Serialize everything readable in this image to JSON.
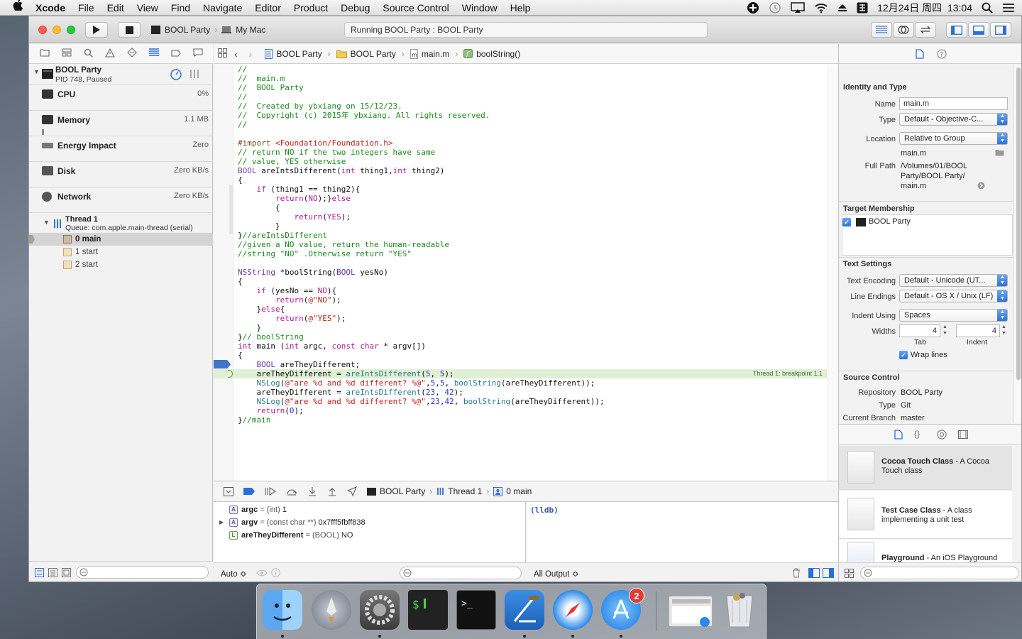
{
  "menubar": {
    "apple": "",
    "items": [
      "Xcode",
      "File",
      "Edit",
      "View",
      "Find",
      "Navigate",
      "Editor",
      "Product",
      "Debug",
      "Source Control",
      "Window",
      "Help"
    ],
    "clock": "12月24日 周四  13:04"
  },
  "toolbar": {
    "scheme": "BOOL Party",
    "destination": "My Mac",
    "activity": "Running BOOL Party : BOOL Party"
  },
  "navigator": {
    "process": {
      "name": "BOOL Party",
      "pid": "PID 748, Paused"
    },
    "gauges": [
      {
        "label": "CPU",
        "value": "0%"
      },
      {
        "label": "Memory",
        "value": "1.1 MB"
      },
      {
        "label": "Energy Impact",
        "value": "Zero"
      },
      {
        "label": "Disk",
        "value": "Zero KB/s"
      },
      {
        "label": "Network",
        "value": "Zero KB/s"
      }
    ],
    "thread": {
      "name": "Thread 1",
      "queue": "Queue: com.apple.main-thread (serial)"
    },
    "frames": [
      "0 main",
      "1 start",
      "2 start"
    ]
  },
  "jumpbar": {
    "project": "BOOL Party",
    "group": "BOOL Party",
    "file": "main.m",
    "symbol": "boolString()"
  },
  "editor": {
    "breakpoint_label": "Thread 1: breakpoint 1.1",
    "lines": [
      [
        [
          "cm",
          "//"
        ]
      ],
      [
        [
          "cm",
          "//  main.m"
        ]
      ],
      [
        [
          "cm",
          "//  BOOL Party"
        ]
      ],
      [
        [
          "cm",
          "//"
        ]
      ],
      [
        [
          "cm",
          "//  Created by ybxiang on 15/12/23."
        ]
      ],
      [
        [
          "cm",
          "//  Copyright (c) 2015年 ybxiang. All rights reserved."
        ]
      ],
      [
        [
          "cm",
          "//"
        ]
      ],
      [
        [
          "pl",
          ""
        ]
      ],
      [
        [
          "pp",
          "#import "
        ],
        [
          "str",
          "<Foundation/Foundation.h>"
        ]
      ],
      [
        [
          "cm",
          "// return NO if the two integers have same"
        ]
      ],
      [
        [
          "cm",
          "// value, YES otherwise"
        ]
      ],
      [
        [
          "ty",
          "BOOL"
        ],
        [
          "pl",
          " areIntsDifferent("
        ],
        [
          "kw",
          "int"
        ],
        [
          "pl",
          " thing1,"
        ],
        [
          "kw",
          "int"
        ],
        [
          "pl",
          " thing2)"
        ]
      ],
      [
        [
          "pl",
          "{"
        ]
      ],
      [
        [
          "pl",
          "    "
        ],
        [
          "kw",
          "if"
        ],
        [
          "pl",
          " (thing1 == thing2){"
        ]
      ],
      [
        [
          "pl",
          "        "
        ],
        [
          "kw",
          "return"
        ],
        [
          "pl",
          "("
        ],
        [
          "kw",
          "NO"
        ],
        [
          "pl",
          ");}"
        ],
        [
          "kw",
          "else"
        ]
      ],
      [
        [
          "pl",
          "        {"
        ]
      ],
      [
        [
          "pl",
          "            "
        ],
        [
          "kw",
          "return"
        ],
        [
          "pl",
          "("
        ],
        [
          "kw",
          "YES"
        ],
        [
          "pl",
          ");"
        ]
      ],
      [
        [
          "pl",
          "        }"
        ]
      ],
      [
        [
          "pl",
          "}"
        ],
        [
          "cm",
          "//areIntsDifferent"
        ]
      ],
      [
        [
          "cm",
          "//given a NO value, return the human-readable"
        ]
      ],
      [
        [
          "cm",
          "//string \"NO\" .Otherwise return \"YES\""
        ]
      ],
      [
        [
          "pl",
          ""
        ]
      ],
      [
        [
          "ty",
          "NSString"
        ],
        [
          "pl",
          " *boolString("
        ],
        [
          "ty",
          "BOOL"
        ],
        [
          "pl",
          " yesNo)"
        ]
      ],
      [
        [
          "pl",
          "{"
        ]
      ],
      [
        [
          "pl",
          "    "
        ],
        [
          "kw",
          "if"
        ],
        [
          "pl",
          " (yesNo == "
        ],
        [
          "kw",
          "NO"
        ],
        [
          "pl",
          "){"
        ]
      ],
      [
        [
          "pl",
          "        "
        ],
        [
          "kw",
          "return"
        ],
        [
          "pl",
          "("
        ],
        [
          "str",
          "@\"NO\""
        ],
        [
          "pl",
          ");"
        ]
      ],
      [
        [
          "pl",
          "    }"
        ],
        [
          "kw",
          "else"
        ],
        [
          "pl",
          "{"
        ]
      ],
      [
        [
          "pl",
          "        "
        ],
        [
          "kw",
          "return"
        ],
        [
          "pl",
          "("
        ],
        [
          "str",
          "@\"YES\""
        ],
        [
          "pl",
          ");"
        ]
      ],
      [
        [
          "pl",
          "    }"
        ]
      ],
      [
        [
          "pl",
          "}"
        ],
        [
          "cm",
          "// boolString"
        ]
      ],
      [
        [
          "kw",
          "int"
        ],
        [
          "pl",
          " main ("
        ],
        [
          "kw",
          "int"
        ],
        [
          "pl",
          " argc, "
        ],
        [
          "kw",
          "const"
        ],
        [
          "pl",
          " "
        ],
        [
          "kw",
          "char"
        ],
        [
          "pl",
          " * argv[])"
        ]
      ],
      [
        [
          "pl",
          "{"
        ]
      ],
      [
        [
          "pl",
          "    "
        ],
        [
          "ty",
          "BOOL"
        ],
        [
          "pl",
          " areTheyDifferent;"
        ]
      ],
      [
        [
          "pl",
          "    areTheyDifferent = "
        ],
        [
          "fn",
          "areIntsDifferent"
        ],
        [
          "pl",
          "("
        ],
        [
          "num",
          "5"
        ],
        [
          "pl",
          ", "
        ],
        [
          "num",
          "5"
        ],
        [
          "pl",
          ");"
        ]
      ],
      [
        [
          "pl",
          "    "
        ],
        [
          "fn",
          "NSLog"
        ],
        [
          "pl",
          "("
        ],
        [
          "str",
          "@\"are %d and %d different? %@\""
        ],
        [
          "pl",
          ","
        ],
        [
          "num",
          "5"
        ],
        [
          "pl",
          ","
        ],
        [
          "num",
          "5"
        ],
        [
          "pl",
          ", "
        ],
        [
          "fn",
          "boolString"
        ],
        [
          "pl",
          "(areTheyDifferent));"
        ]
      ],
      [
        [
          "pl",
          "    areTheyDifferent = "
        ],
        [
          "fn",
          "areIntsDifferent"
        ],
        [
          "pl",
          "("
        ],
        [
          "num",
          "23"
        ],
        [
          "pl",
          ", "
        ],
        [
          "num",
          "42"
        ],
        [
          "pl",
          ");"
        ]
      ],
      [
        [
          "pl",
          "    "
        ],
        [
          "fn",
          "NSLog"
        ],
        [
          "pl",
          "("
        ],
        [
          "str",
          "@\"are %d and %d different? %@\""
        ],
        [
          "pl",
          ","
        ],
        [
          "num",
          "23"
        ],
        [
          "pl",
          ","
        ],
        [
          "num",
          "42"
        ],
        [
          "pl",
          ", "
        ],
        [
          "fn",
          "boolString"
        ],
        [
          "pl",
          "(areTheyDifferent));"
        ]
      ],
      [
        [
          "pl",
          "    "
        ],
        [
          "kw",
          "return"
        ],
        [
          "pl",
          "("
        ],
        [
          "num",
          "0"
        ],
        [
          "pl",
          ");"
        ]
      ],
      [
        [
          "pl",
          "}"
        ],
        [
          "cm",
          "//main"
        ]
      ]
    ]
  },
  "debugbar": {
    "process": "BOOL Party",
    "thread": "Thread 1",
    "frame": "0 main"
  },
  "variables": [
    {
      "badge": "A",
      "name": "argc",
      "type": "= (int)",
      "value": "1"
    },
    {
      "badge": "A",
      "name": "argv",
      "type": "= (const char **)",
      "value": "0x7fff5fbff838"
    },
    {
      "badge": "L",
      "name": "areTheyDifferent",
      "type": "= (BOOL)",
      "value": "NO"
    }
  ],
  "console": {
    "prompt": "(lldb)"
  },
  "debug_bottom": {
    "auto": "Auto ≎",
    "output": "All Output ≎"
  },
  "inspector": {
    "identity_title": "Identity and Type",
    "name_label": "Name",
    "name_value": "main.m",
    "type_label": "Type",
    "type_value": "Default - Objective-C...",
    "location_label": "Location",
    "location_value": "Relative to Group",
    "location_file": "main.m",
    "fullpath_label": "Full Path",
    "fullpath_lines": [
      "/Volumes/01/BOOL",
      "Party/BOOL Party/",
      "main.m"
    ],
    "target_title": "Target Membership",
    "target_item": "BOOL Party",
    "text_title": "Text Settings",
    "encoding_label": "Text Encoding",
    "encoding_value": "Default - Unicode (UT...",
    "endings_label": "Line Endings",
    "endings_value": "Default - OS X / Unix (LF)",
    "indent_label": "Indent Using",
    "indent_value": "Spaces",
    "widths_label": "Widths",
    "tab_value": "4",
    "indent_num": "4",
    "tab_label": "Tab",
    "indent_sub": "Indent",
    "wrap_label": "Wrap lines",
    "sc_title": "Source Control",
    "repo_label": "Repository",
    "repo_value": "BOOL Party",
    "sctype_label": "Type",
    "sctype_value": "Git",
    "branch_label": "Current Branch",
    "branch_value": "master"
  },
  "library": [
    {
      "title": "Cocoa Touch Class",
      "desc": " - A Cocoa Touch class"
    },
    {
      "title": "Test Case Class",
      "desc": " - A class implementing a unit test"
    },
    {
      "title": "Playground",
      "desc": " - An iOS Playground"
    }
  ],
  "dock": {
    "appstore_badge": "2"
  },
  "colors": {
    "accent": "#2a74db",
    "breakpoint": "#3f74c9",
    "comment": "#1d8a1d",
    "keyword": "#b01c9c",
    "string": "#c4221a"
  }
}
